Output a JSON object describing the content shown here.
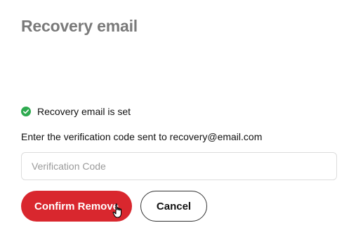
{
  "page": {
    "title": "Recovery email"
  },
  "status": {
    "icon": "check-circle-icon",
    "text": "Recovery email is set",
    "color": "#2eaa4f"
  },
  "verification": {
    "instruction": "Enter the verification code sent to recovery@email.com",
    "input_value": "",
    "placeholder": "Verification Code"
  },
  "actions": {
    "confirm_label": "Confirm Remove",
    "cancel_label": "Cancel",
    "confirm_color": "#d9272e"
  },
  "pointer": {
    "icon": "hand-pointer-icon"
  }
}
